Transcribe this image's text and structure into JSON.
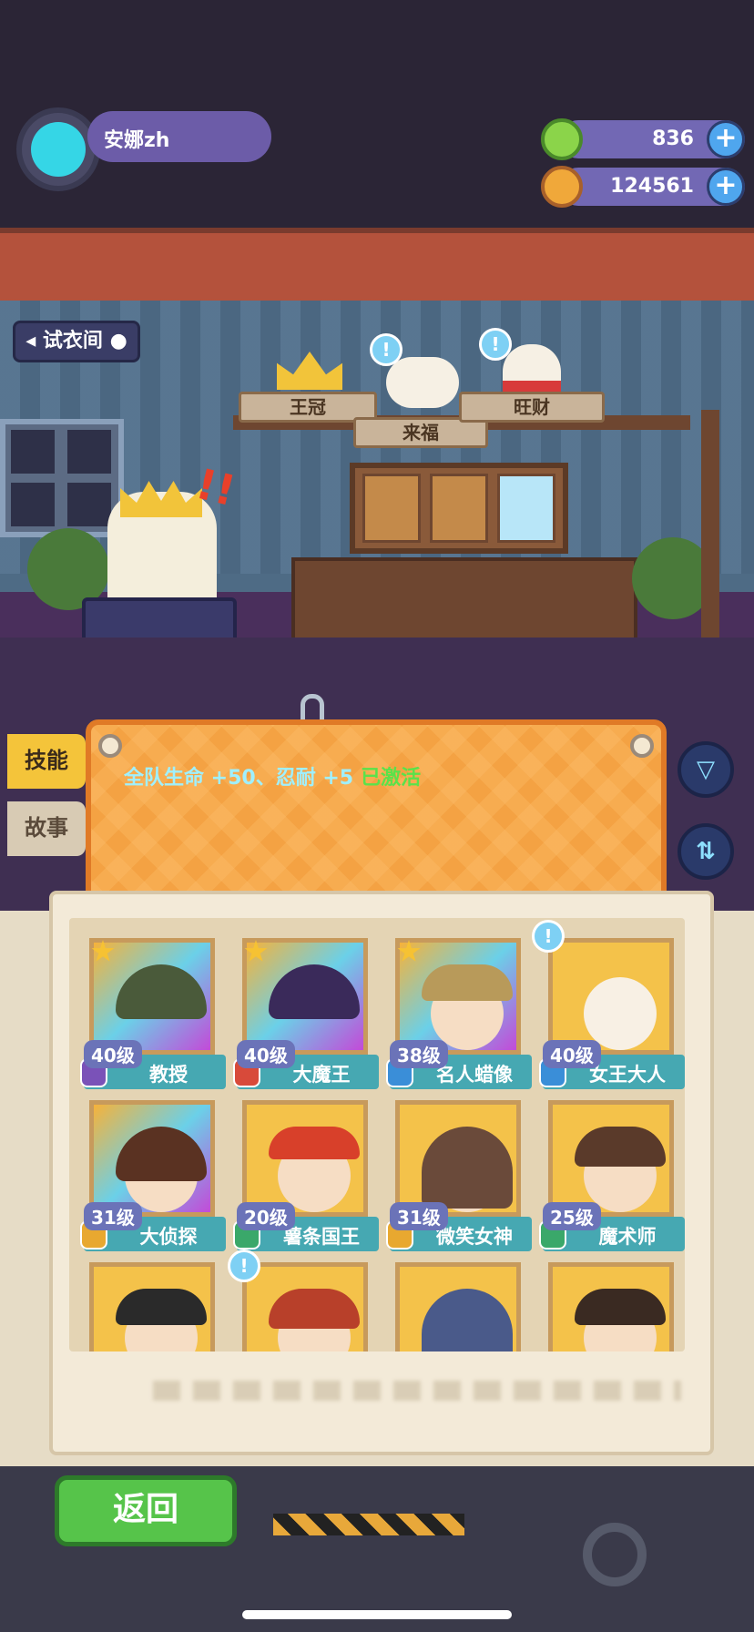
{
  "player": {
    "name": "安娜zh"
  },
  "currencies": [
    {
      "icon": "green-gem-coin-icon",
      "value": "836"
    },
    {
      "icon": "planet-coin-icon",
      "value": "124561"
    }
  ],
  "room": {
    "fitting_room_label": "试衣间",
    "plaques": {
      "crown": "王冠",
      "center": "来福",
      "right": "旺财"
    }
  },
  "tabs": {
    "skills": "技能",
    "story": "故事"
  },
  "skill": {
    "text": "全队生命 +50、忍耐 +5",
    "status": "已激活"
  },
  "colors": {
    "skill_text": "#9ff0ff",
    "active_status": "#5ae24a",
    "name_bar": "#46a8b2",
    "back_button": "#56c44a"
  },
  "cards": [
    {
      "level": "40级",
      "name": "教授",
      "starred": true,
      "badge_color": "#7a52b8"
    },
    {
      "level": "40级",
      "name": "大魔王",
      "starred": true,
      "badge_color": "#d84a3a"
    },
    {
      "level": "38级",
      "name": "名人蜡像",
      "starred": true,
      "badge_color": "#3a8ed8"
    },
    {
      "level": "40级",
      "name": "女王大人",
      "starred": false,
      "badge_color": "#3a8ed8"
    },
    {
      "level": "31级",
      "name": "大侦探",
      "starred": false,
      "badge_color": "#e8a830"
    },
    {
      "level": "20级",
      "name": "薯条国王",
      "starred": false,
      "badge_color": "#3aa86a"
    },
    {
      "level": "31级",
      "name": "微笑女神",
      "starred": false,
      "badge_color": "#e8a830"
    },
    {
      "level": "25级",
      "name": "魔术师",
      "starred": false,
      "badge_color": "#3aa86a"
    }
  ],
  "bottom": {
    "back_label": "返回"
  }
}
